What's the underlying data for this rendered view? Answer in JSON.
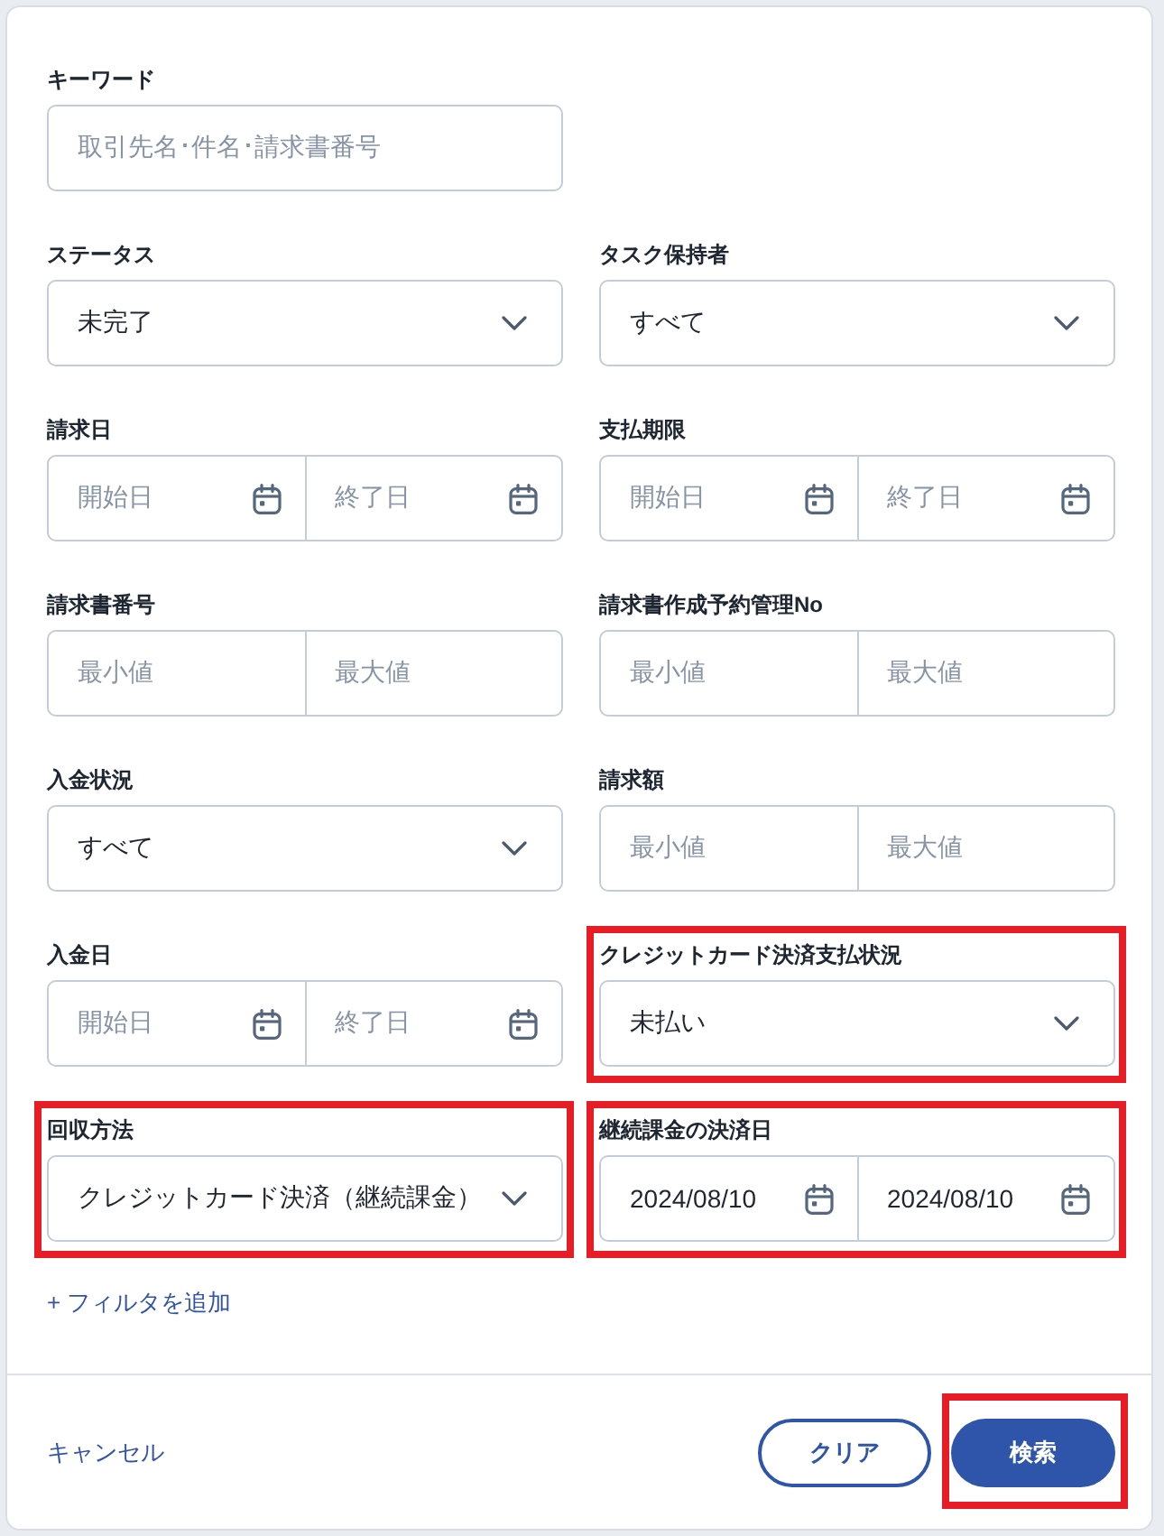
{
  "rows": [
    [
      {
        "kind": "text",
        "label": "キーワード",
        "placeholder": "取引先名･件名･請求書番号",
        "highlighted": false
      }
    ],
    [
      {
        "kind": "select",
        "label": "ステータス",
        "value": "未完了",
        "highlighted": false
      },
      {
        "kind": "select",
        "label": "タスク保持者",
        "value": "すべて",
        "highlighted": false
      }
    ],
    [
      {
        "kind": "date_range",
        "label": "請求日",
        "start": {
          "placeholder": "開始日"
        },
        "end": {
          "placeholder": "終了日"
        },
        "highlighted": false
      },
      {
        "kind": "date_range",
        "label": "支払期限",
        "start": {
          "placeholder": "開始日"
        },
        "end": {
          "placeholder": "終了日"
        },
        "highlighted": false
      }
    ],
    [
      {
        "kind": "number_range",
        "label": "請求書番号",
        "min": {
          "placeholder": "最小値"
        },
        "max": {
          "placeholder": "最大値"
        },
        "highlighted": false
      },
      {
        "kind": "number_range",
        "label": "請求書作成予約管理No",
        "min": {
          "placeholder": "最小値"
        },
        "max": {
          "placeholder": "最大値"
        },
        "highlighted": false
      }
    ],
    [
      {
        "kind": "select",
        "label": "入金状況",
        "value": "すべて",
        "highlighted": false
      },
      {
        "kind": "number_range",
        "label": "請求額",
        "min": {
          "placeholder": "最小値"
        },
        "max": {
          "placeholder": "最大値"
        },
        "highlighted": false
      }
    ],
    [
      {
        "kind": "date_range",
        "label": "入金日",
        "start": {
          "placeholder": "開始日"
        },
        "end": {
          "placeholder": "終了日"
        },
        "highlighted": false
      },
      {
        "kind": "select",
        "label": "クレジットカード決済支払状況",
        "value": "未払い",
        "highlighted": true
      }
    ],
    [
      {
        "kind": "select",
        "label": "回収方法",
        "value": "クレジットカード決済（継続課金）",
        "highlighted": true
      },
      {
        "kind": "date_range",
        "label": "継続課金の決済日",
        "start": {
          "value": "2024/08/10"
        },
        "end": {
          "value": "2024/08/10"
        },
        "highlighted": true
      }
    ]
  ],
  "add_filter": "+ フィルタを追加",
  "footer": {
    "cancel": "キャンセル",
    "buttons": [
      {
        "kind": "outline",
        "label": "クリア",
        "highlighted": false
      },
      {
        "kind": "primary",
        "label": "検索",
        "highlighted": true
      }
    ]
  }
}
